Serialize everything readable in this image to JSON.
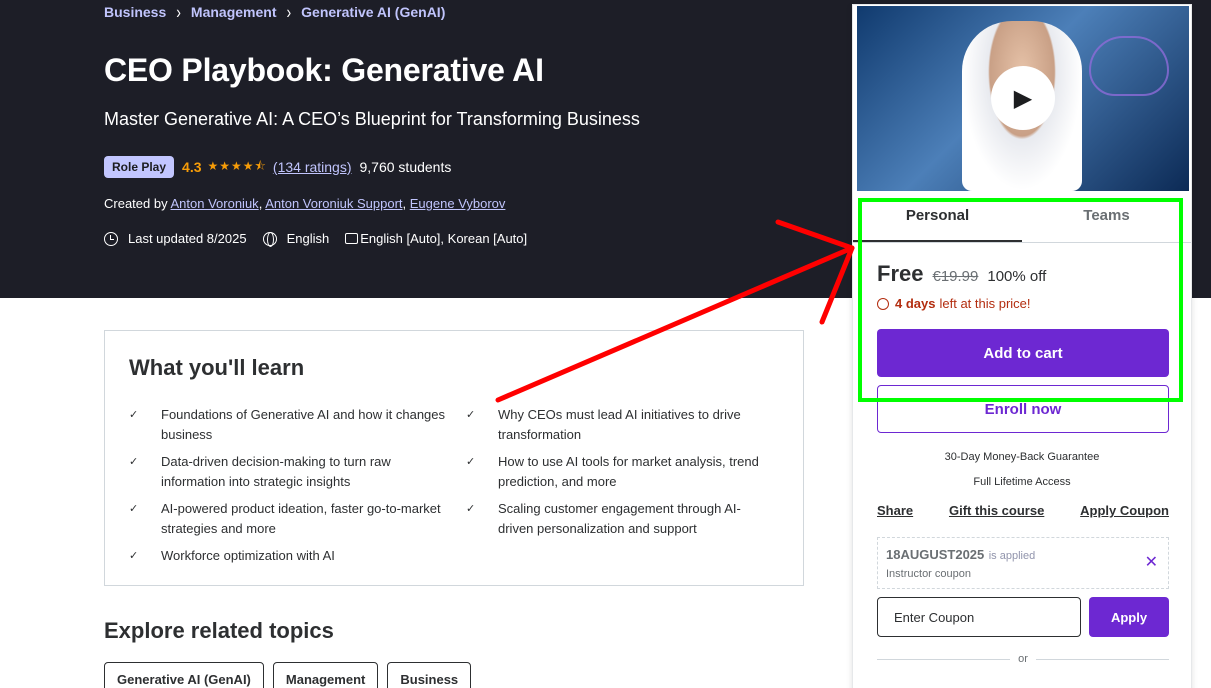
{
  "breadcrumb": [
    "Business",
    "Management",
    "Generative AI (GenAI)"
  ],
  "course": {
    "title": "CEO Playbook: Generative AI",
    "subtitle": "Master Generative AI: A CEO’s Blueprint for Transforming Business",
    "badge": "Role Play",
    "rating": "4.3",
    "rating_stars": 4.3,
    "ratings_count": "(134 ratings)",
    "students": "9,760 students",
    "created_by_label": "Created by",
    "authors": [
      "Anton Voroniuk",
      "Anton Voroniuk Support",
      "Eugene Vyborov"
    ],
    "last_updated": "Last updated 8/2025",
    "language": "English",
    "captions": "English [Auto], Korean [Auto]"
  },
  "learn": {
    "title": "What you'll learn",
    "items": [
      "Foundations of Generative AI and how it changes business",
      "Why CEOs must lead AI initiatives to drive transformation",
      "Data-driven decision-making to turn raw information into strategic insights",
      "How to use AI tools for market analysis, trend prediction, and more",
      "AI-powered product ideation, faster go-to-market strategies and more",
      "Scaling customer engagement through AI-driven personalization and support",
      "Workforce optimization with AI"
    ]
  },
  "explore": {
    "title": "Explore related topics",
    "topics": [
      "Generative AI (GenAI)",
      "Management",
      "Business"
    ]
  },
  "sidebar": {
    "tabs": [
      "Personal",
      "Teams"
    ],
    "price": "Free",
    "original_price": "€19.99",
    "discount": "100% off",
    "days_left": "4 days",
    "days_left_suffix": "left at this price!",
    "add_to_cart": "Add to cart",
    "enroll_now": "Enroll now",
    "guarantee": "30-Day Money-Back Guarantee",
    "lifetime": "Full Lifetime Access",
    "links": [
      "Share",
      "Gift this course",
      "Apply Coupon"
    ],
    "coupon_code": "18AUGUST2025",
    "coupon_applied_text": "is applied",
    "coupon_sub": "Instructor coupon",
    "coupon_placeholder": "Enter Coupon",
    "apply": "Apply",
    "or": "or"
  },
  "annotation_colors": {
    "arrow": "#ff0000",
    "highlight_box": "#00ff00"
  }
}
